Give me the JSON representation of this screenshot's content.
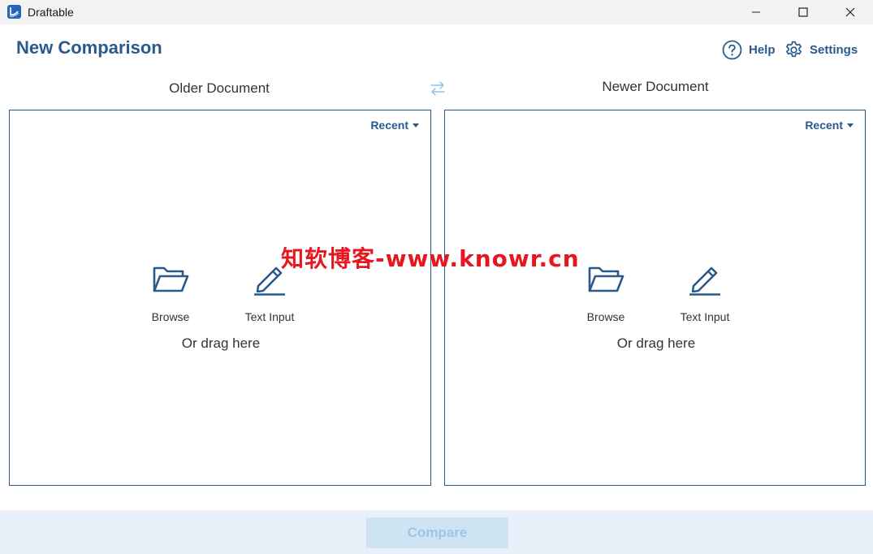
{
  "window": {
    "title": "Draftable",
    "minimize_icon": "minimize-icon",
    "maximize_icon": "maximize-icon",
    "close_icon": "close-icon"
  },
  "header": {
    "title": "New Comparison",
    "help_label": "Help",
    "settings_label": "Settings"
  },
  "older": {
    "heading": "Older Document",
    "recent_label": "Recent",
    "browse_label": "Browse",
    "text_input_label": "Text Input",
    "drag_hint": "Or drag here"
  },
  "newer": {
    "heading": "Newer Document",
    "recent_label": "Recent",
    "browse_label": "Browse",
    "text_input_label": "Text Input",
    "drag_hint": "Or drag here"
  },
  "footer": {
    "compare_label": "Compare"
  },
  "watermark": "知软博客-www.knowr.cn",
  "colors": {
    "accent": "#2a5a8c",
    "footer_bg": "#e8f1f9",
    "compare_disabled_bg": "#cfe4f3",
    "compare_disabled_text": "#9ac7e6",
    "watermark": "#e8171f"
  }
}
